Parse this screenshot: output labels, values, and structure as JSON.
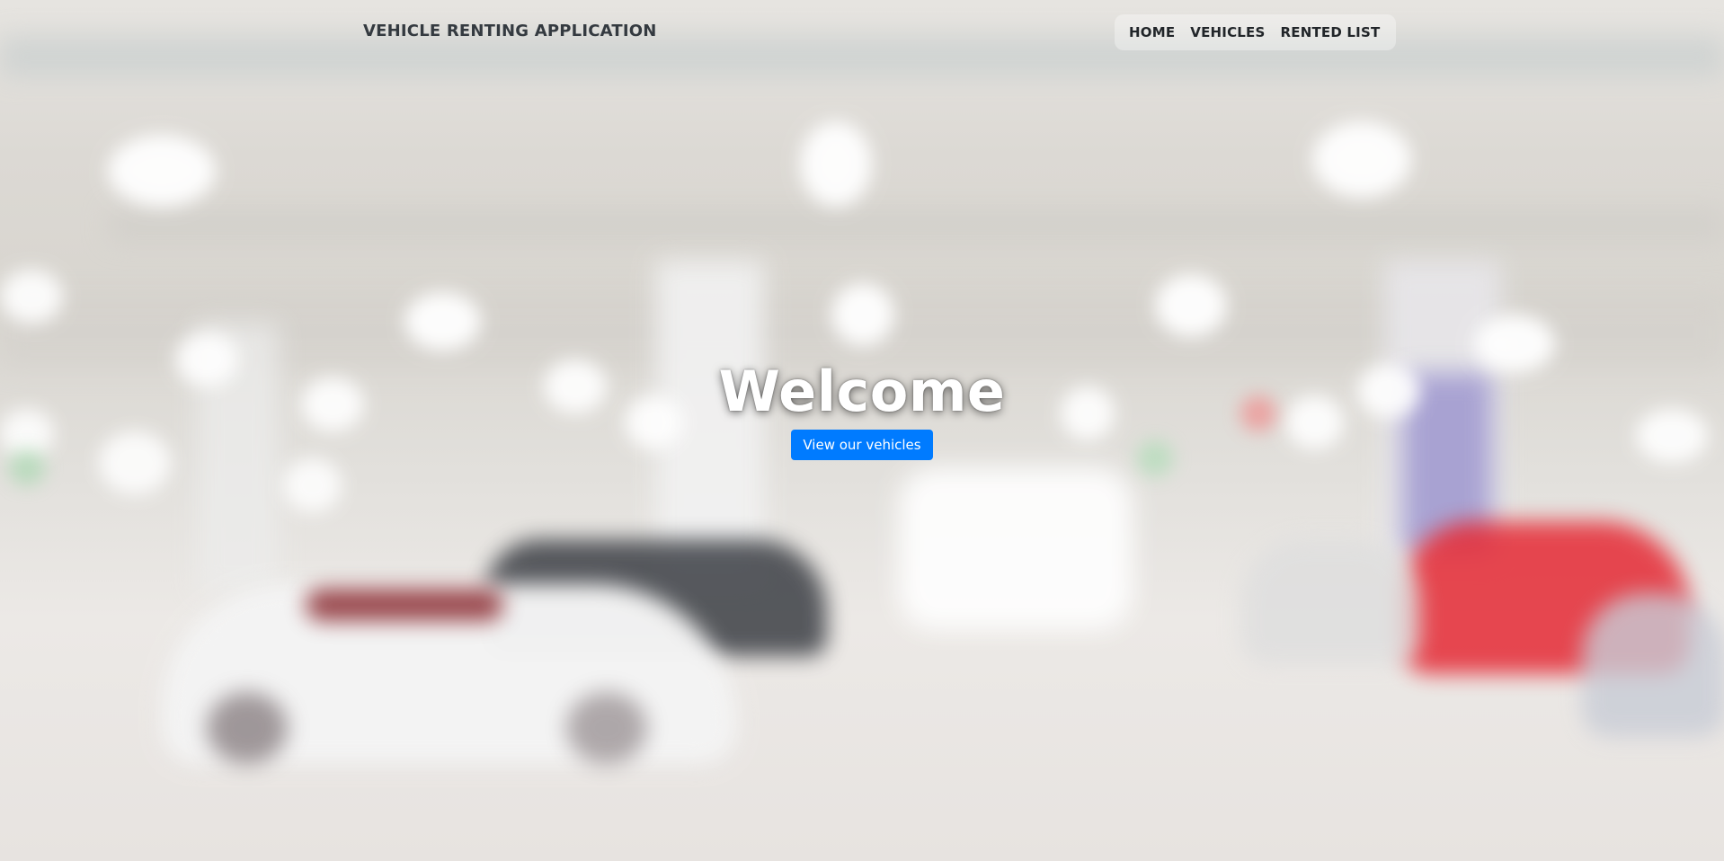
{
  "navbar": {
    "brand": "VEHICLE RENTING APPLICATION",
    "links": [
      {
        "label": "HOME"
      },
      {
        "label": "VEHICLES"
      },
      {
        "label": "RENTED LIST"
      }
    ]
  },
  "hero": {
    "title": "Welcome",
    "button_label": "View our vehicles"
  },
  "colors": {
    "accent": "#007bff",
    "nav_text": "#212529",
    "brand_text": "#343a40"
  }
}
